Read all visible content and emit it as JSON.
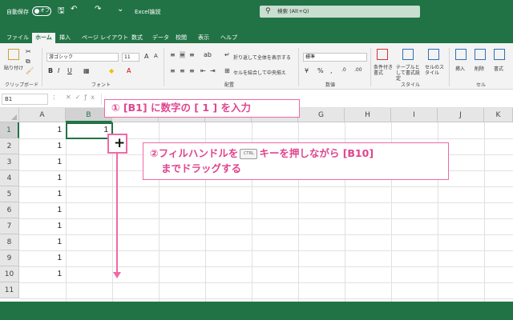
{
  "titlebar": {
    "autosave_label": "自動保存",
    "autosave_state": "オフ",
    "title": "Excel論説",
    "search_placeholder": "検索 (Alt+Q)"
  },
  "menu": {
    "items": [
      "ファイル",
      "ホーム",
      "挿入",
      "ページ レイアウト",
      "数式",
      "データ",
      "校閲",
      "表示",
      "ヘルプ"
    ],
    "active": "ホーム"
  },
  "ribbon": {
    "clipboard": {
      "paste": "貼り付け",
      "label": "クリップボード"
    },
    "font": {
      "name": "游ゴシック",
      "size": "11",
      "label": "フォント",
      "bold": "B",
      "italic": "I",
      "underline": "U"
    },
    "alignment": {
      "wrap": "折り返して全体を表示する",
      "merge": "セルを結合して中央揃え",
      "label": "配置"
    },
    "number": {
      "format": "標準",
      "label": "数値"
    },
    "styles": {
      "conditional": "条件付き書式",
      "table": "テーブルとして書式設定",
      "cell": "セルのスタイル",
      "label": "スタイル"
    },
    "cells": {
      "insert": "挿入",
      "delete": "削除",
      "format": "書式",
      "label": "セル"
    }
  },
  "formula_bar": {
    "name_box": "B1",
    "content": ""
  },
  "grid": {
    "columns": [
      "A",
      "B",
      "C",
      "D",
      "E",
      "F",
      "G",
      "H",
      "I",
      "J",
      "K"
    ],
    "rows": [
      "1",
      "2",
      "3",
      "4",
      "5",
      "6",
      "7",
      "8",
      "9",
      "10",
      "11"
    ],
    "column_a_values": [
      "1",
      "1",
      "1",
      "1",
      "1",
      "1",
      "1",
      "1",
      "1",
      "1"
    ],
    "b1_value": "1"
  },
  "annotations": {
    "step1": "① [B1] に数字の [ 1 ] を入力",
    "step2_part1": "②フィルハンドルを",
    "ctrl_key": "CTRL",
    "step2_part2": "キーを押しながら [B10]",
    "step2_line2": "までドラッグする",
    "accent_color": "#ef6aa5"
  }
}
